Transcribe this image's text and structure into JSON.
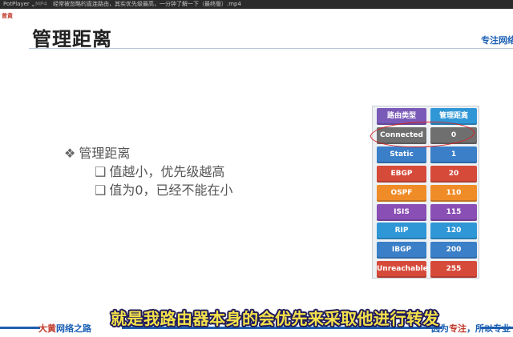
{
  "player": {
    "app_name": "PotPlayer",
    "format": "MP4",
    "video_title": "经常被忽略的直连路由，其实优先级最高，一分钟了解一下（最终版）.mp4"
  },
  "slide": {
    "corner_brand": "曾黄",
    "title": "管理距离",
    "brand_right": "专注网络",
    "bullets": {
      "main": "管理距离",
      "sub1": "值越小，优先级越高",
      "sub2": "值为0，已经不能在小"
    },
    "table": {
      "header": [
        "路由类型",
        "管理距离"
      ],
      "rows": [
        {
          "type": "Connected",
          "distance": "0",
          "color": "#6f6f6f"
        },
        {
          "type": "Static",
          "distance": "1",
          "color": "#3a7fc8"
        },
        {
          "type": "EBGP",
          "distance": "20",
          "color": "#d64a3a"
        },
        {
          "type": "OSPF",
          "distance": "110",
          "color": "#f08c28"
        },
        {
          "type": "ISIS",
          "distance": "115",
          "color": "#8a4fb5"
        },
        {
          "type": "RIP",
          "distance": "120",
          "color": "#2f97d6"
        },
        {
          "type": "IBGP",
          "distance": "200",
          "color": "#3a7fc8"
        },
        {
          "type": "Unreachable",
          "distance": "255",
          "color": "#d64a3a"
        }
      ],
      "header_colors": [
        "#7a5ab8",
        "#2f97d6"
      ],
      "highlighted_row": "Connected"
    },
    "footer": {
      "brand_red": "大黄",
      "brand_blue": "网络之路",
      "slogan_red": "专注",
      "slogan_prefix": "因为",
      "slogan_suffix": "，所以专业"
    }
  },
  "subtitle": "就是我路由器本身的会优先来采取他进行转发"
}
